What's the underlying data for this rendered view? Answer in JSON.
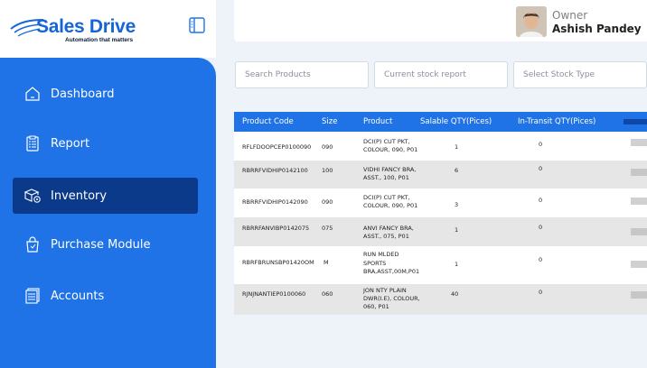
{
  "brand": {
    "title": "Sales Drive",
    "tagline": "Automation that matters"
  },
  "sidebar": {
    "items": [
      {
        "label": "Dashboard",
        "icon": "home-icon",
        "active": false
      },
      {
        "label": "Report",
        "icon": "report-icon",
        "active": false
      },
      {
        "label": "Inventory",
        "icon": "inventory-icon",
        "active": true
      },
      {
        "label": "Purchase Module",
        "icon": "shopping-bag-icon",
        "active": false
      },
      {
        "label": "Accounts",
        "icon": "accounts-icon",
        "active": false
      }
    ]
  },
  "header": {
    "role": "Owner",
    "name": "Ashish Pandey"
  },
  "filters": {
    "search_placeholder": "Search Products",
    "report_placeholder": "Current stock report",
    "stock_type_placeholder": "Select Stock Type"
  },
  "table": {
    "columns": [
      "Product Code",
      "Size",
      "Product",
      "Salable QTY(Pices)",
      "In-Transit QTY(Pices)"
    ],
    "rows": [
      {
        "code": "RFLFDOOPCEP0100090",
        "size": "090",
        "product": [
          "DCI(P) CUT PKT,",
          "COLOUR, 090, P01"
        ],
        "salable": "1",
        "transit": "0"
      },
      {
        "code": "RBRRFVIDHIP0142100",
        "size": "100",
        "product": [
          "VIDHI FANCY BRA,",
          "ASST., 100, P01"
        ],
        "salable": "6",
        "transit": "0"
      },
      {
        "code": "RBRRFVIDHIP0142090",
        "size": "090",
        "product": [
          "DCI(P) CUT PKT,",
          "COLOUR, 090, P01"
        ],
        "salable": "3",
        "transit": "0"
      },
      {
        "code": "RBRRFANVIBP0142075",
        "size": "075",
        "product": [
          "ANVI FANCY BRA,",
          "ASST., 075, P01"
        ],
        "salable": "1",
        "transit": "0"
      },
      {
        "code": "RBRFBRUNSBP01420OM",
        "size": "M",
        "product": [
          "RUN MLDED",
          "SPORTS",
          "BRA,ASST,00M,P01"
        ],
        "salable": "1",
        "transit": "0"
      },
      {
        "code": "RJNJNANTIEP0100060",
        "size": "060",
        "product": [
          "JON NTY PLAIN",
          "DWR(I.E), COLOUR,",
          "060, P01"
        ],
        "salable": "40",
        "transit": "0"
      }
    ]
  },
  "colors": {
    "primary": "#1f73e6",
    "active_nav": "#0b3a8a",
    "background": "#eef3fa"
  }
}
